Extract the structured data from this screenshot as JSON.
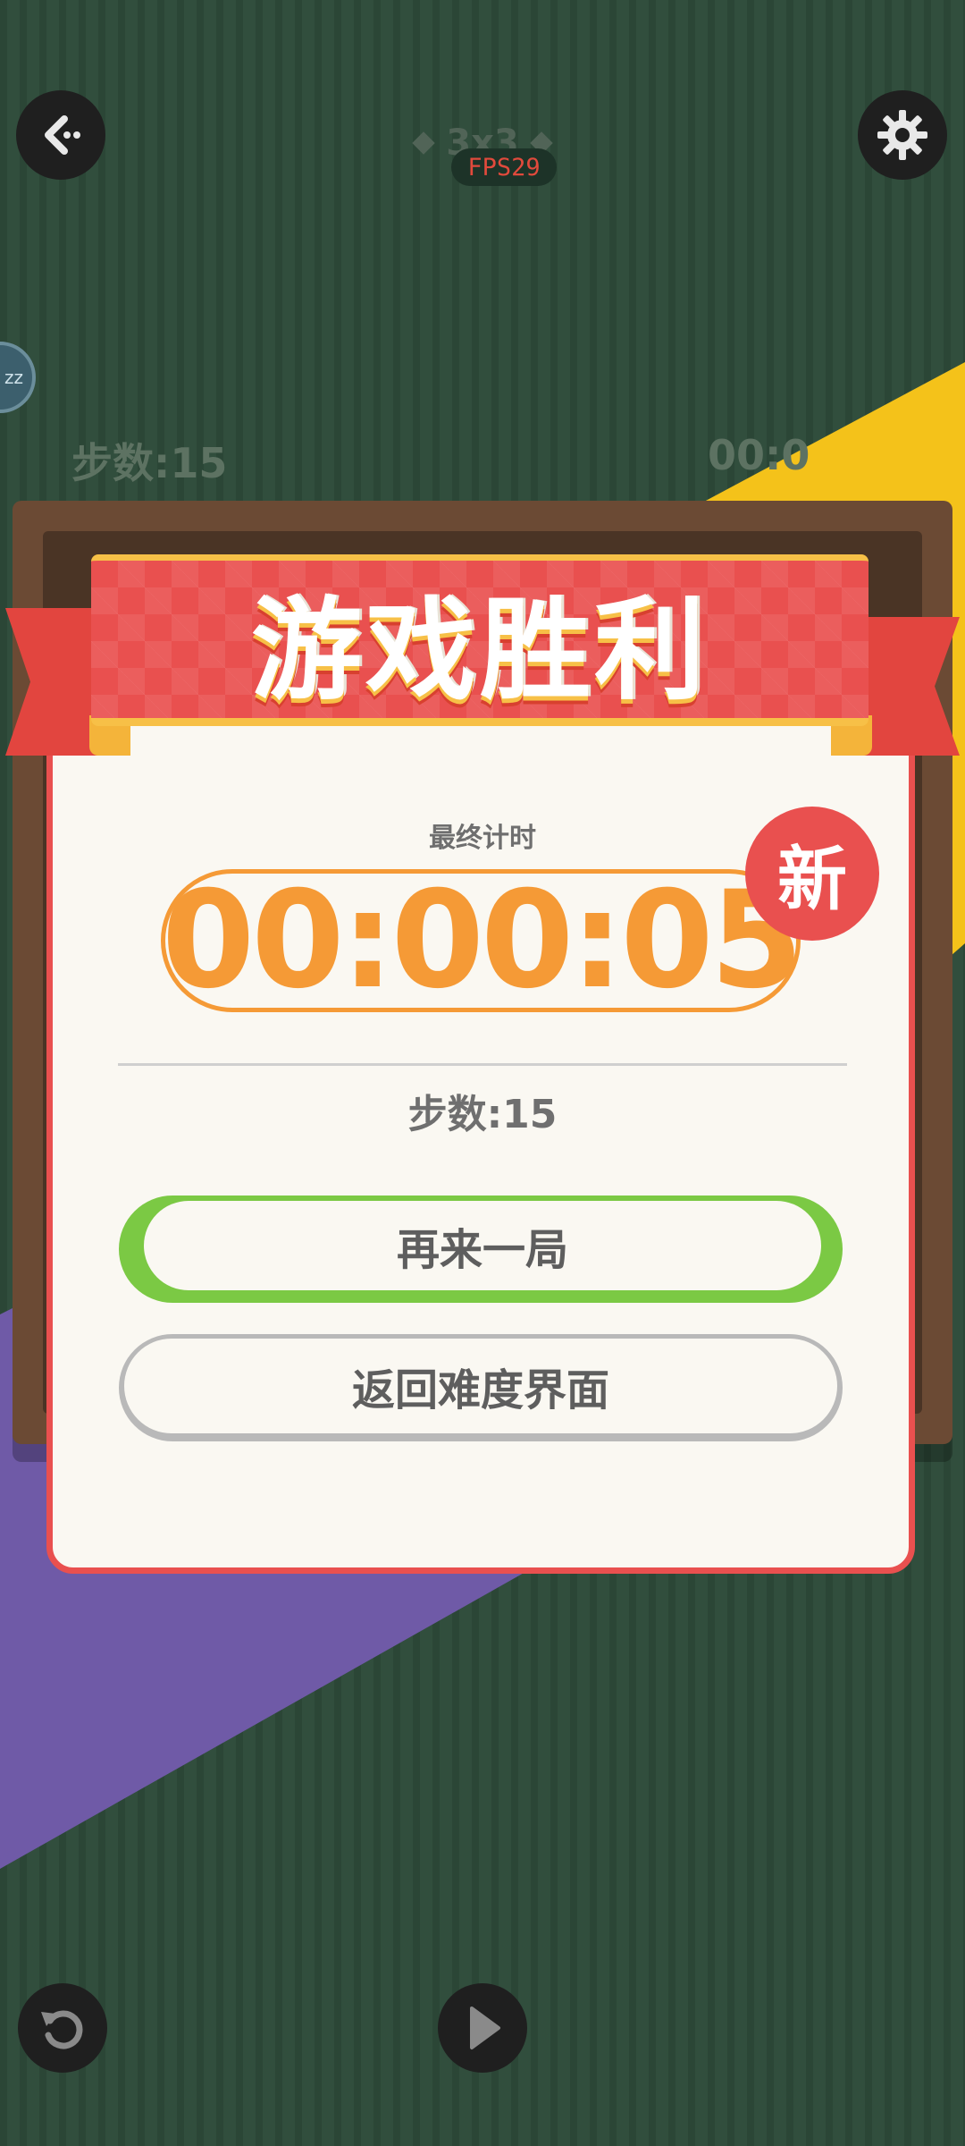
{
  "top_bar": {
    "back_icon": "back-arrow-icon",
    "grid_size": "3x3",
    "fps": "FPS29",
    "settings_icon": "gear-icon"
  },
  "side_chip": {
    "label": "zz"
  },
  "game_status": {
    "steps": "步数:15",
    "timer_partial": "00:0"
  },
  "dialog": {
    "title": "游戏胜利",
    "final_time_label": "最终计时",
    "final_time": "00:00:05",
    "new_badge": "新",
    "steps": "步数:15",
    "play_again_label": "再来一局",
    "back_label": "返回难度界面"
  },
  "bottom_bar": {
    "restart_icon": "restart-icon",
    "play_icon": "play-icon"
  },
  "colors": {
    "background": "#2d4a39",
    "accent_red": "#e9504f",
    "accent_orange": "#f59a36",
    "accent_green": "#7bc944",
    "accent_yellow": "#f4c21a",
    "accent_purple": "#6f5aa7"
  }
}
